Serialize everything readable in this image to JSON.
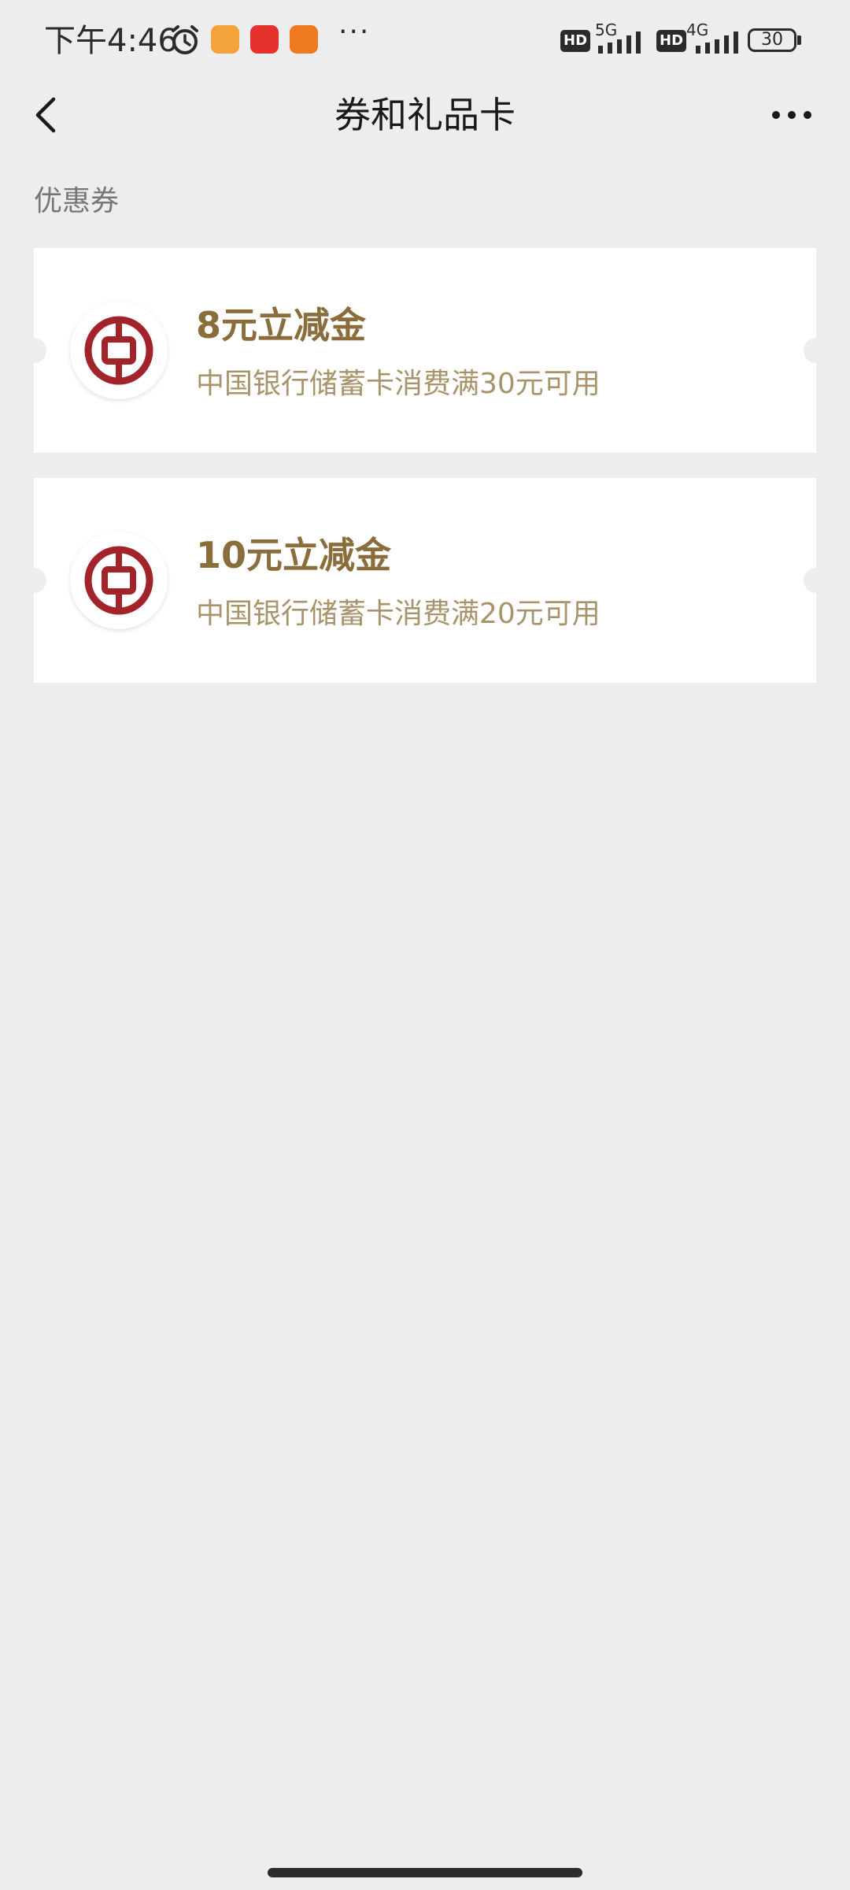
{
  "status_bar": {
    "time": "下午4:46",
    "network_1": "5G",
    "network_2": "4G",
    "hd_1": "HD",
    "hd_2": "HD",
    "battery": "30",
    "more": "···"
  },
  "navbar": {
    "title": "券和礼品卡"
  },
  "section": {
    "title": "优惠券"
  },
  "coupons": [
    {
      "title": "8元立减金",
      "description": "中国银行储蓄卡消费满30元可用"
    },
    {
      "title": "10元立减金",
      "description": "中国银行储蓄卡消费满20元可用"
    }
  ],
  "colors": {
    "background": "#ededed",
    "coupon_title": "#8a6d3b",
    "coupon_desc": "#a8946a",
    "bank_red": "#a3232b"
  }
}
